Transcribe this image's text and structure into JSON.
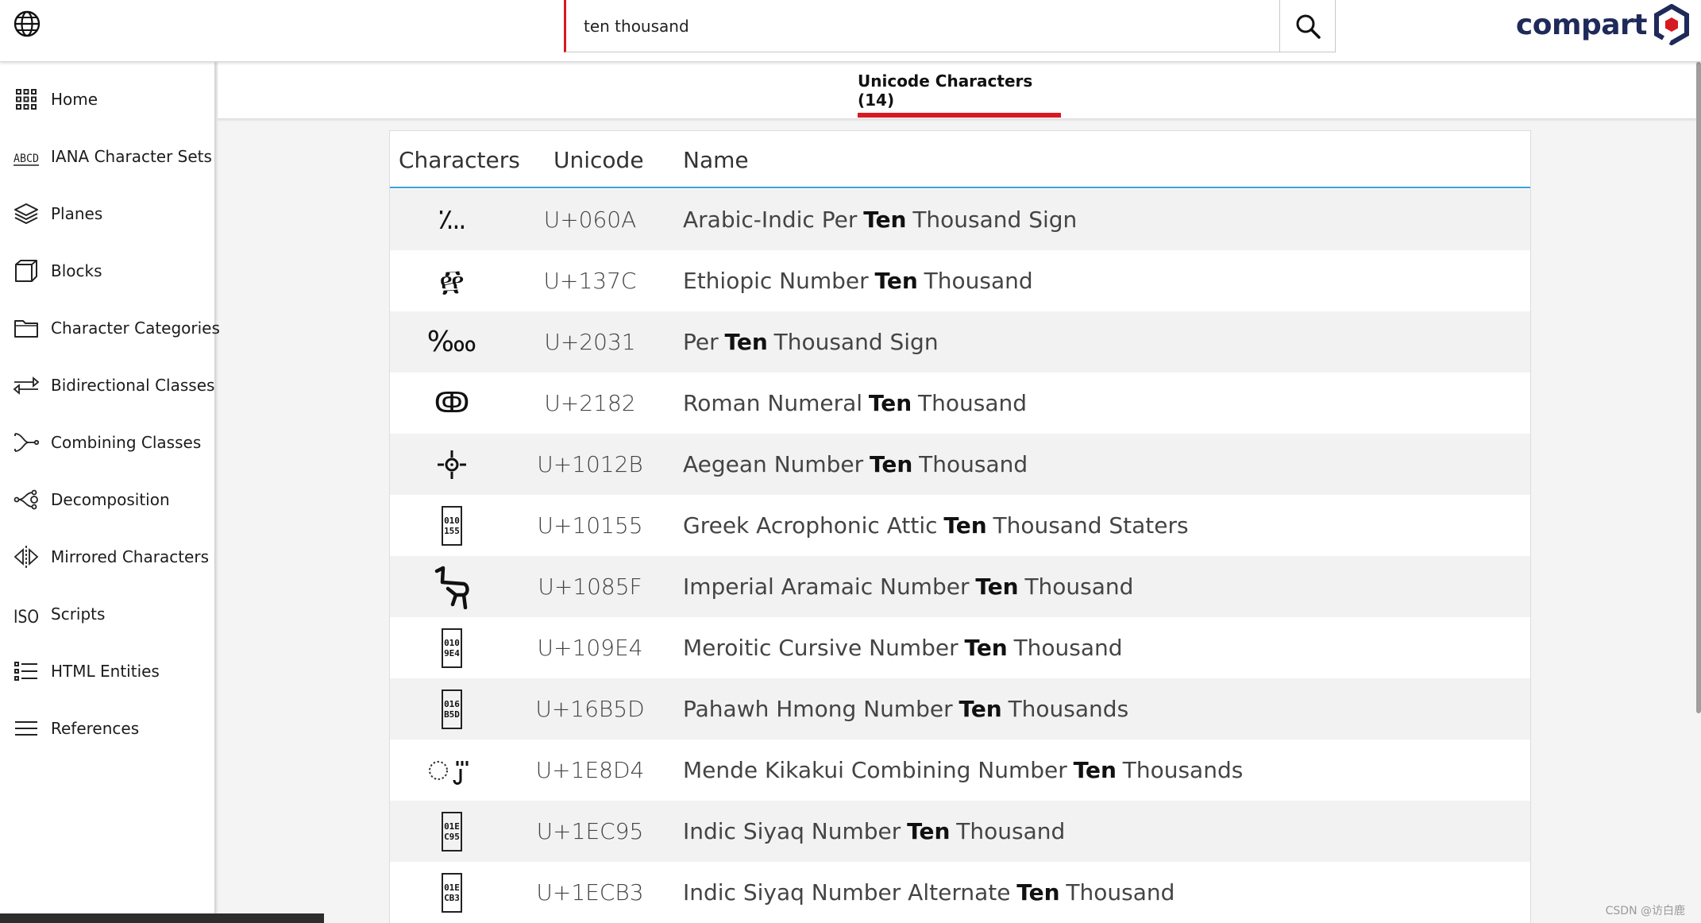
{
  "header": {
    "search_value": "ten thousand",
    "brand": "compart",
    "icons": {
      "globe": "globe-icon",
      "search": "search-icon",
      "logo": "compart-hexagon-logo-icon"
    }
  },
  "sidebar": {
    "items": [
      {
        "label": "Home",
        "icon": "grid-icon"
      },
      {
        "label": "IANA Character Sets",
        "icon": "abcd-icon"
      },
      {
        "label": "Planes",
        "icon": "layers-icon"
      },
      {
        "label": "Blocks",
        "icon": "cube-icon"
      },
      {
        "label": "Character Categories",
        "icon": "folder-icon"
      },
      {
        "label": "Bidirectional Classes",
        "icon": "bidi-arrows-icon"
      },
      {
        "label": "Combining Classes",
        "icon": "combining-icon"
      },
      {
        "label": "Decomposition",
        "icon": "decomposition-icon"
      },
      {
        "label": "Mirrored Characters",
        "icon": "mirror-icon"
      },
      {
        "label": "Scripts",
        "icon": "iso-icon"
      },
      {
        "label": "HTML Entities",
        "icon": "list-icon"
      },
      {
        "label": "References",
        "icon": "menu-lines-icon"
      }
    ]
  },
  "tabs": {
    "active": "Unicode Characters (14)"
  },
  "table": {
    "headers": {
      "characters": "Characters",
      "unicode": "Unicode",
      "name": "Name"
    },
    "rows": [
      {
        "char": "٪",
        "code": "U+060A",
        "pre": "Arabic-Indic Per",
        "hl": "Ten",
        "post": "Thousand Sign",
        "glyph": "text",
        "display": "؊"
      },
      {
        "char": "፼",
        "code": "U+137C",
        "pre": "Ethiopic Number",
        "hl": "Ten",
        "post": "Thousand",
        "glyph": "text",
        "display": "፼"
      },
      {
        "char": "‱",
        "code": "U+2031",
        "pre": "Per",
        "hl": "Ten",
        "post": "Thousand Sign",
        "glyph": "text",
        "display": "‱"
      },
      {
        "char": "ↂ",
        "code": "U+2182",
        "pre": "Roman Numeral",
        "hl": "Ten",
        "post": "Thousand",
        "glyph": "text",
        "display": "ↂ"
      },
      {
        "char": "",
        "code": "U+1012B",
        "pre": "Aegean Number",
        "hl": "Ten",
        "post": "Thousand",
        "glyph": "aegean"
      },
      {
        "char": "",
        "code": "U+10155",
        "pre": "Greek Acrophonic Attic",
        "hl": "Ten",
        "post": "Thousand Staters",
        "glyph": "hex",
        "hex1": "010",
        "hex2": "155"
      },
      {
        "char": "",
        "code": "U+1085F",
        "pre": "Imperial Aramaic Number",
        "hl": "Ten",
        "post": "Thousand",
        "glyph": "aramaic"
      },
      {
        "char": "",
        "code": "U+109E4",
        "pre": "Meroitic Cursive Number",
        "hl": "Ten",
        "post": "Thousand",
        "glyph": "hex",
        "hex1": "010",
        "hex2": "9E4"
      },
      {
        "char": "",
        "code": "U+16B5D",
        "pre": "Pahawh Hmong Number",
        "hl": "Ten",
        "post": "Thousands",
        "glyph": "hex",
        "hex1": "016",
        "hex2": "B5D"
      },
      {
        "char": "",
        "code": "U+1E8D4",
        "pre": "Mende Kikakui Combining Number",
        "hl": "Ten",
        "post": "Thousands",
        "glyph": "mende"
      },
      {
        "char": "",
        "code": "U+1EC95",
        "pre": "Indic Siyaq Number",
        "hl": "Ten",
        "post": "Thousand",
        "glyph": "hex",
        "hex1": "01E",
        "hex2": "C95"
      },
      {
        "char": "",
        "code": "U+1ECB3",
        "pre": "Indic Siyaq Number Alternate",
        "hl": "Ten",
        "post": "Thousand",
        "glyph": "hex",
        "hex1": "01E",
        "hex2": "CB3"
      }
    ]
  },
  "footer": {
    "watermark": "CSDN @访白鹿"
  },
  "colors": {
    "accent": "#d71921",
    "brand": "#1e2a5a",
    "table_rule": "#39a3d4"
  }
}
